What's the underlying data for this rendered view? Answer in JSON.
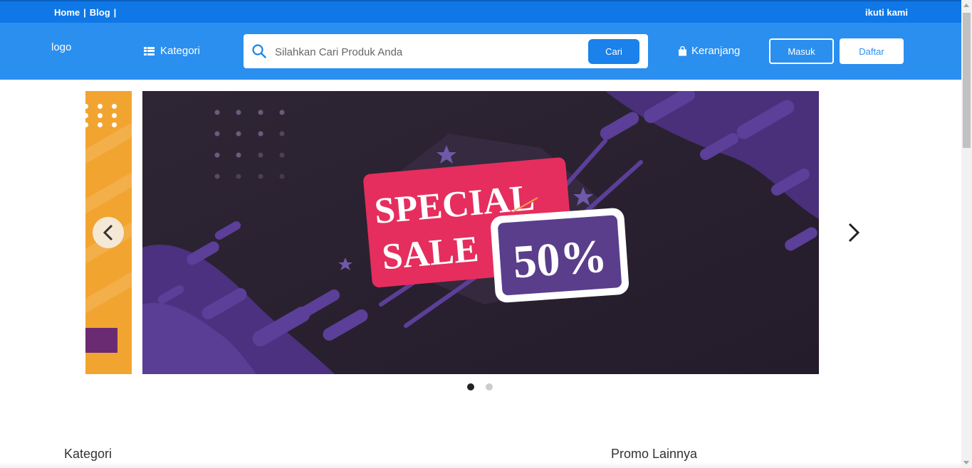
{
  "topbar": {
    "links": [
      "Home",
      "Blog"
    ],
    "separator": "|",
    "follow": "ikuti kami"
  },
  "header": {
    "logo": "logo",
    "kategori_label": "Kategori",
    "search": {
      "placeholder": "Silahkan Cari Produk Anda",
      "value": ""
    },
    "search_button": "Cari",
    "cart_label": "Keranjang",
    "login_label": "Masuk",
    "register_label": "Daftar"
  },
  "carousel": {
    "banner_line1": "SPECIAL",
    "banner_line2": "SALE",
    "banner_percent": "50%",
    "active_index": 0,
    "slide_count": 2
  },
  "sections": {
    "kategori_title": "Kategori",
    "promo_title": "Promo Lainnya"
  },
  "colors": {
    "topbar": "#0f77e6",
    "header": "#2b8ff0",
    "button": "#1a82ea",
    "banner_pink": "#e52e5e",
    "banner_purple": "#5a3e8c",
    "banner_bg": "#2a2230",
    "side_slide": "#f2a430"
  },
  "icons": [
    "list-icon",
    "search-icon",
    "shopping-bag-icon",
    "chevron-left-icon",
    "chevron-right-icon"
  ]
}
